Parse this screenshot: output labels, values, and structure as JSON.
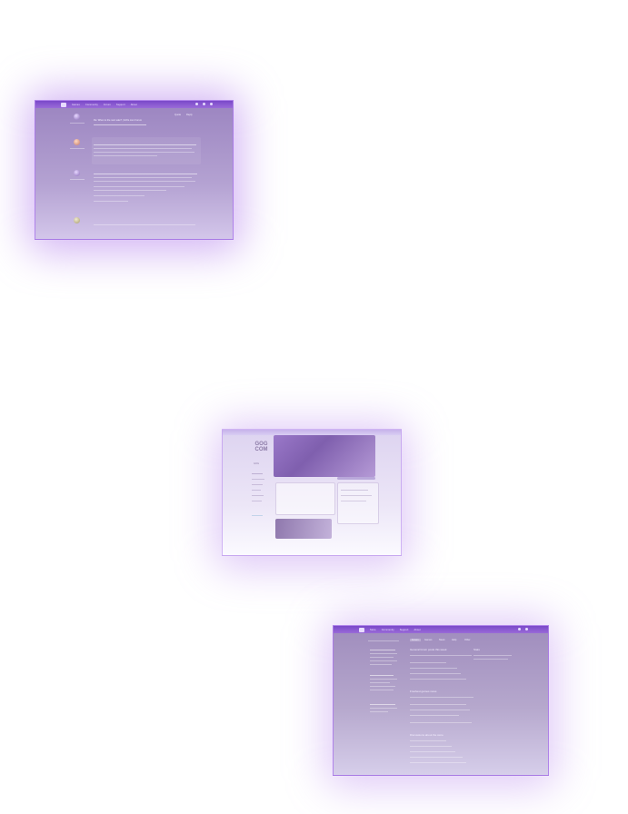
{
  "forum_window": {
    "nav": [
      "GOG",
      "Games",
      "Community",
      "Forum",
      "Support",
      "About"
    ],
    "post_title": "Re: When is the next sale? | GOG.com Forum",
    "reply_label": "Reply",
    "quote_label": "Quote"
  },
  "gog_page": {
    "logo_line1": "GOG",
    "logo_line2": "COM",
    "sidebar_items": [
      "Home",
      "Games",
      "Movies",
      "Forum",
      "News",
      "Wishlist",
      "Settings"
    ],
    "highlight": "GOG"
  },
  "news_window": {
    "nav": [
      "GOG",
      "Store",
      "Community",
      "Support",
      "About"
    ],
    "sections": [
      "General forum posts this week",
      "Freshest games news",
      "Discussions about the store"
    ],
    "tabs": [
      "Forum",
      "Games",
      "News",
      "Help",
      "Other"
    ],
    "side_heading": "Stats"
  },
  "colors": {
    "accent": "#8a55d6",
    "glow": "#b58cf0",
    "panel": "#a68fc4"
  }
}
